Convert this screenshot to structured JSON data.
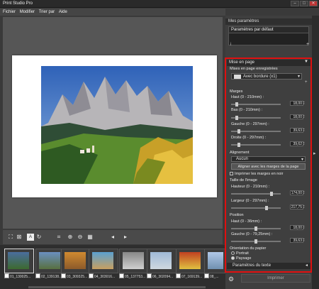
{
  "window": {
    "title": "Print Studio Pro",
    "minimize": "–",
    "maximize": "□",
    "close": "✕"
  },
  "menu": [
    "Fichier",
    "Modifier",
    "Trier par",
    "Aide"
  ],
  "settings": {
    "header": "Mes paramètres",
    "preset": "Paramètres par défaut",
    "info_glyph": "i",
    "add_glyph": "+"
  },
  "layout": {
    "header": "Mise en page",
    "saved_label": "Mises en page enregistrées",
    "saved_value": "Avec bordure (x1)",
    "plus_glyph": "+",
    "margins_label": "Marges",
    "fields": [
      {
        "label": "Haut (0 - 210mm) :",
        "value": "18,00",
        "level": 0.09
      },
      {
        "label": "Bas (0 - 210mm) :",
        "value": "18,00",
        "level": 0.09
      },
      {
        "label": "Gauche (0 - 297mm) :",
        "value": "39,63",
        "level": 0.13
      },
      {
        "label": "Droite (0 - 297mm) :",
        "value": "39,62",
        "level": 0.13
      }
    ],
    "alignment_label": "Alignement",
    "alignment_value": "Aucun",
    "align_button": "Aligner avec les marges de la page",
    "print_margins_label": "Imprimer les marges en noir",
    "image_size_label": "Taille de l'image",
    "size_fields": [
      {
        "label": "Hauteur (0 - 210mm) :",
        "value": "174,00",
        "level": 0.83
      },
      {
        "label": "Largeur (0 - 297mm) :",
        "value": "217,75",
        "level": 0.73
      }
    ],
    "position_label": "Position",
    "position_fields": [
      {
        "label": "Haut (0 - 36mm) :",
        "value": "18,00",
        "level": 0.5
      },
      {
        "label": "Gauche (0 - 79,25mm) :",
        "value": "39,63",
        "level": 0.5
      }
    ],
    "orientation_label": "Orientation du papier",
    "portrait": "Portrait",
    "landscape": "Paysage",
    "text_settings": "Paramètres du texte"
  },
  "print_button": "Imprimer",
  "toolbar_icons": [
    "fit-icon",
    "actual-size-icon",
    "text-icon",
    "rotate-icon",
    "crop-icon",
    "zoom-in-icon",
    "zoom-out-icon",
    "grid-icon",
    "prev-icon",
    "next-icon"
  ],
  "thumbnails": [
    {
      "label": "01_130025...",
      "colors": [
        "#4a6d9e",
        "#3d6a2f"
      ]
    },
    {
      "label": "02_139138...",
      "colors": [
        "#6a8fc0",
        "#587040"
      ]
    },
    {
      "label": "03_309325...",
      "colors": [
        "#d08a30",
        "#8c5a2a"
      ]
    },
    {
      "label": "04_303016...",
      "colors": [
        "#5aa0d0",
        "#c8a060"
      ]
    },
    {
      "label": "05_137753...",
      "colors": [
        "#888888",
        "#d0d0d0"
      ]
    },
    {
      "label": "06_302094...",
      "colors": [
        "#9fb9d6",
        "#cfd8e0"
      ]
    },
    {
      "label": "07_169139...",
      "colors": [
        "#c04020",
        "#e0c040"
      ]
    },
    {
      "label": "08_...",
      "colors": [
        "#b0c8e8",
        "#7090b0"
      ]
    }
  ]
}
